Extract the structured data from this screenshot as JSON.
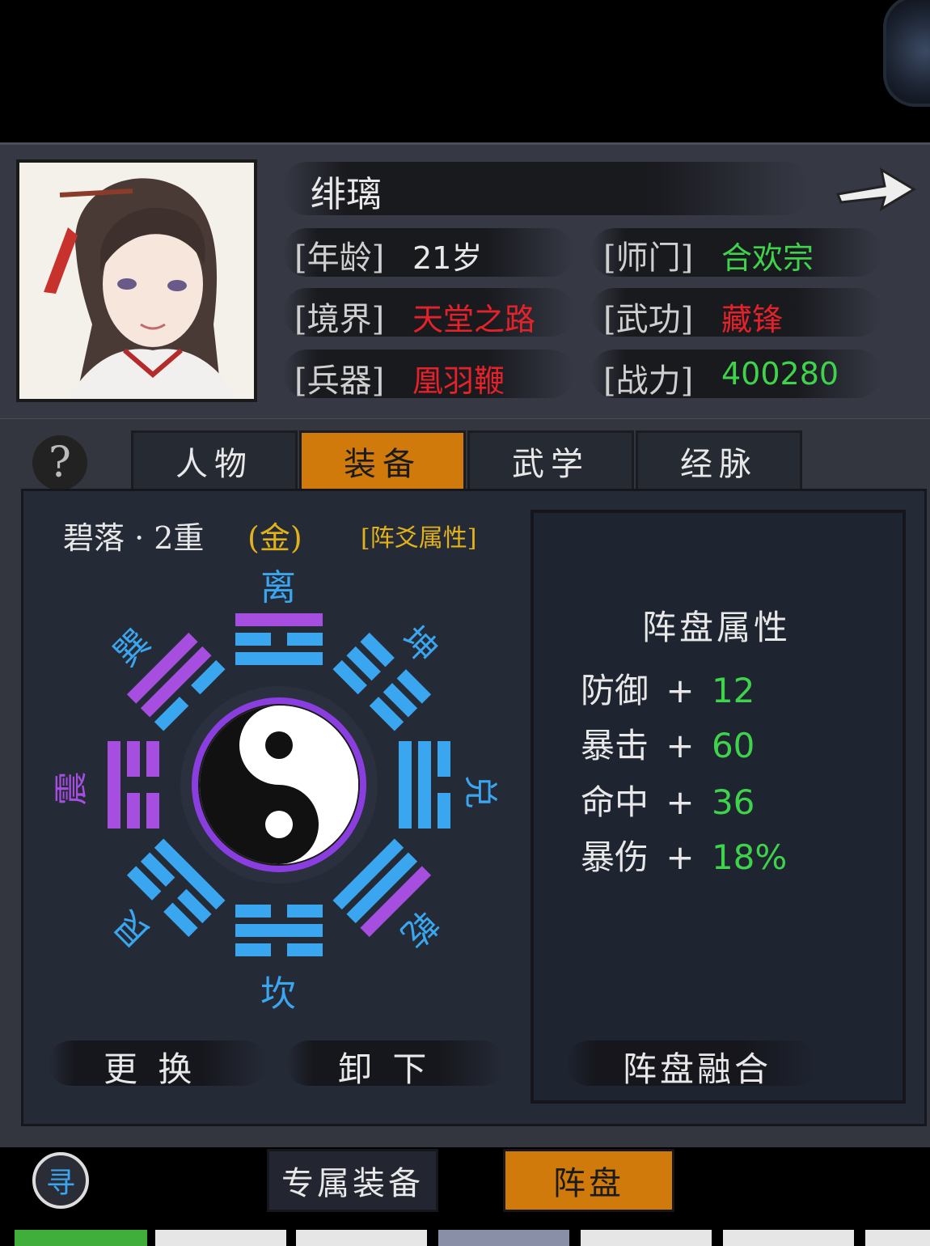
{
  "header": {
    "name": "绯璃",
    "rows": [
      [
        {
          "label": "[年龄]",
          "value": "21岁",
          "color": "#e8e8e8"
        },
        {
          "label": "[师门]",
          "value": "合欢宗",
          "color": "#3fd34b"
        }
      ],
      [
        {
          "label": "[境界]",
          "value": "天堂之路",
          "color": "#e3222a"
        },
        {
          "label": "[武功]",
          "value": "藏锋",
          "color": "#e3222a"
        }
      ],
      [
        {
          "label": "[兵器]",
          "value": "凰羽鞭",
          "color": "#e3222a"
        },
        {
          "label": "[战力]",
          "value": "400280",
          "color": "#3fd34b"
        }
      ]
    ],
    "next_icon": "arrow-right-icon"
  },
  "tabs": [
    {
      "label": "人物",
      "active": false
    },
    {
      "label": "装备",
      "active": true
    },
    {
      "label": "武学",
      "active": false
    },
    {
      "label": "经脉",
      "active": false
    }
  ],
  "help_icon": "?",
  "formation": {
    "name": "碧落 · 2重",
    "grade": "(金)",
    "attr_link": "[阵爻属性]",
    "trigrams": [
      {
        "name": "离",
        "color": "#3aa6f0"
      },
      {
        "name": "坤",
        "color": "#3aa6f0"
      },
      {
        "name": "兑",
        "color": "#3aa6f0"
      },
      {
        "name": "乾",
        "color": "#3aa6f0"
      },
      {
        "name": "坎",
        "color": "#3aa6f0"
      },
      {
        "name": "艮",
        "color": "#3aa6f0"
      },
      {
        "name": "震",
        "color": "#a64ee0"
      },
      {
        "name": "巽",
        "color": "#3aa6f0"
      }
    ],
    "center_icon": "yin-yang-icon"
  },
  "attributes": {
    "title": "阵盘属性",
    "items": [
      {
        "label": "防御",
        "plus": "+",
        "value": "12"
      },
      {
        "label": "暴击",
        "plus": "+",
        "value": "60"
      },
      {
        "label": "命中",
        "plus": "+",
        "value": "36"
      },
      {
        "label": "暴伤",
        "plus": "+",
        "value": "18%"
      }
    ]
  },
  "actions": {
    "replace": "更 换",
    "unequip": "卸 下",
    "fuse": "阵盘融合"
  },
  "bottom_tabs": [
    {
      "label": "专属装备",
      "active": false
    },
    {
      "label": "阵盘",
      "active": true
    }
  ],
  "search_icon_glyph": "寻"
}
